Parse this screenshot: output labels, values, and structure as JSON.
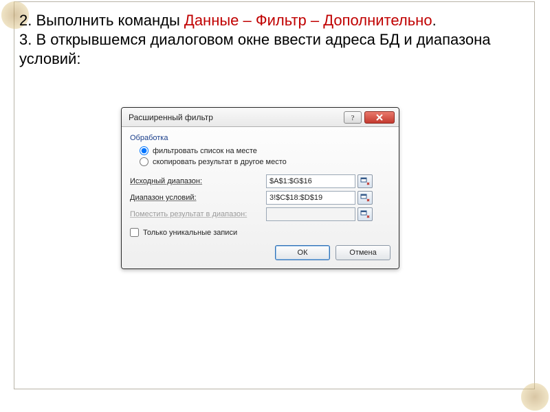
{
  "instructions": {
    "line1_prefix": "2. Выполнить команды ",
    "line1_red": "Данные – Фильтр – Дополнительно",
    "line1_suffix": ".",
    "line2": "3. В открывшемся диалоговом окне ввести адреса БД и диапазона условий:"
  },
  "dialog": {
    "title": "Расширенный фильтр",
    "section_processing": "Обработка",
    "radio_in_place": "фильтровать список на месте",
    "radio_copy_to": "скопировать результат в другое место",
    "label_source_range": "Исходный диапазон:",
    "label_criteria_range": "Диапазон условий:",
    "label_copy_to_range": "Поместить результат в диапазон:",
    "input_source_value": "$A$1:$G$16",
    "input_criteria_value": "3!$C$18:$D$19",
    "input_copy_to_value": "",
    "checkbox_unique": "Только уникальные записи",
    "btn_ok": "ОК",
    "btn_cancel": "Отмена",
    "help_glyph": "?",
    "close_glyph": "✕"
  }
}
